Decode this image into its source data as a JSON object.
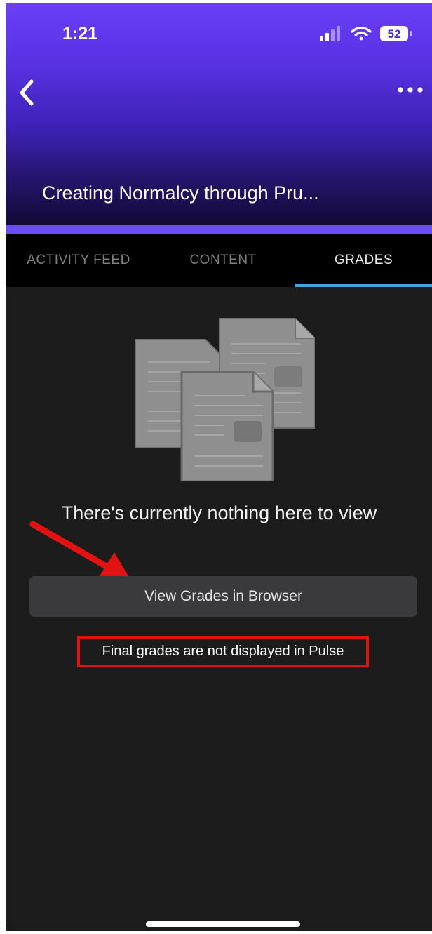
{
  "status_bar": {
    "time": "1:21",
    "battery": "52",
    "icons": [
      "signal-icon",
      "wifi-icon",
      "battery-icon"
    ]
  },
  "nav": {
    "back_icon": "chevron-left-icon",
    "more_icon": "more-horizontal-icon",
    "title": "Creating Normalcy through Pru..."
  },
  "tabs": [
    {
      "label": "ACTIVITY FEED",
      "active": false
    },
    {
      "label": "CONTENT",
      "active": false
    },
    {
      "label": "GRADES",
      "active": true
    }
  ],
  "empty_state": {
    "illustration": "documents-stack-icon",
    "message": "There's currently nothing here to view"
  },
  "action_button": {
    "label": "View Grades in Browser"
  },
  "notice": {
    "text": "Final grades are not displayed in Pulse"
  },
  "colors": {
    "header_gradient_top": "#6a3ff7",
    "accent_bar": "#6c4dfa",
    "tab_underline": "#47a3d8",
    "background": "#1c1c1c",
    "annotation_red": "#e21212"
  }
}
